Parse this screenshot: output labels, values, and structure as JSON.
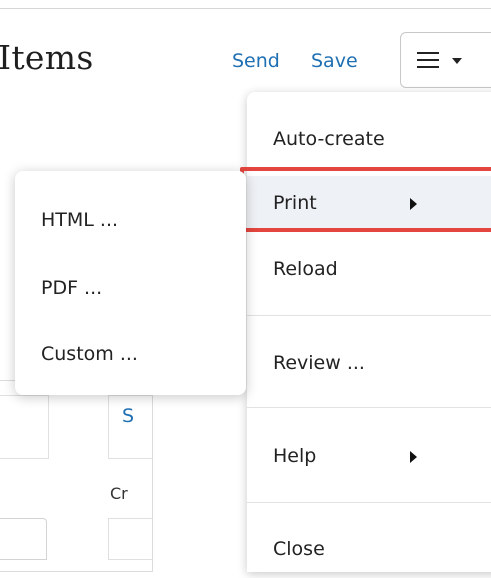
{
  "header": {
    "title": "Items",
    "send_label": "Send",
    "save_label": "Save",
    "menu_icon": "hamburger-icon",
    "dropdown_icon": "caret-down-icon"
  },
  "background": {
    "partial_link": "S",
    "partial_text": "Cr"
  },
  "menu": {
    "items": [
      {
        "label": "Auto-create"
      },
      {
        "label": "Print",
        "has_submenu": true,
        "highlighted": true
      },
      {
        "label": "Reload"
      },
      {
        "label": "Review ..."
      },
      {
        "label": "Help",
        "has_submenu": true
      },
      {
        "label": "Close"
      }
    ]
  },
  "submenu": {
    "items": [
      {
        "label": "HTML ..."
      },
      {
        "label": "PDF ..."
      },
      {
        "label": "Custom ..."
      }
    ]
  },
  "colors": {
    "link": "#1f6fb3",
    "highlight_border": "#e4453e",
    "selected_bg": "#eef1f5"
  }
}
